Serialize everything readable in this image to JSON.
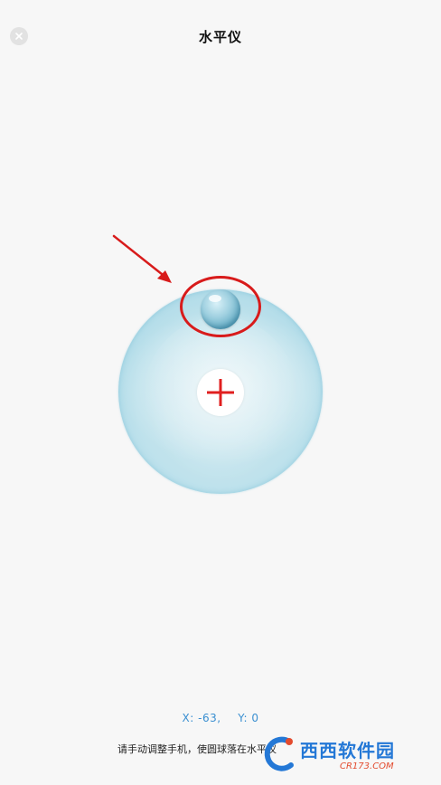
{
  "header": {
    "title": "水平仪",
    "close_icon": "close-icon"
  },
  "level": {
    "center_icon": "plus-icon",
    "ball_icon": "bubble-ball",
    "colors": {
      "accent": "#e01f1f",
      "bubble": "#bfe2ec",
      "ball": "#5fa9c2"
    }
  },
  "readout": {
    "x_label": "X:",
    "x_value": "-63,",
    "y_label": "Y:",
    "y_value": "0"
  },
  "hint": {
    "text": "请手动调整手机，使圆球落在水平仪"
  },
  "watermark": {
    "brand": "西西软件园",
    "site": "CR173.COM"
  },
  "annotation": {
    "color": "#d81b1b"
  }
}
